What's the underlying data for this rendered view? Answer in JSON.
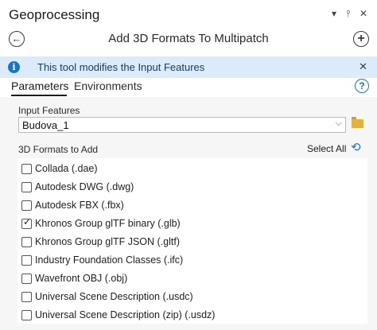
{
  "pane": {
    "title": "Geoprocessing",
    "controls": {
      "menu_glyph": "▾",
      "pin_glyph": "⫯",
      "close_glyph": "✕"
    }
  },
  "nav": {
    "back_glyph": "←",
    "add_glyph": "+",
    "tool_title": "Add 3D Formats To Multipatch"
  },
  "info": {
    "icon_glyph": "i",
    "message": "This tool modifies the Input Features",
    "close_glyph": "✕"
  },
  "tabs": {
    "parameters": "Parameters",
    "environments": "Environments",
    "help_glyph": "?"
  },
  "params": {
    "input_features_label": "Input Features",
    "input_features_value": "Budova_1",
    "chevron_glyph": "⌵",
    "formats_label": "3D Formats to Add",
    "select_all": "Select All",
    "refresh_glyph": "⟲",
    "formats": [
      {
        "label": "Collada (.dae)",
        "checked": false
      },
      {
        "label": "Autodesk DWG (.dwg)",
        "checked": false
      },
      {
        "label": "Autodesk FBX (.fbx)",
        "checked": false
      },
      {
        "label": "Khronos Group glTF binary (.glb)",
        "checked": true
      },
      {
        "label": "Khronos Group glTF JSON (.gltf)",
        "checked": false
      },
      {
        "label": "Industry Foundation Classes (.ifc)",
        "checked": false
      },
      {
        "label": "Wavefront OBJ (.obj)",
        "checked": false
      },
      {
        "label": "Universal Scene Description (.usdc)",
        "checked": false
      },
      {
        "label": "Universal Scene Description (zip) (.usdz)",
        "checked": false
      }
    ],
    "check_glyph": "✓"
  },
  "colors": {
    "accent": "#1b73c6",
    "info_bar_bg": "#dcebf9"
  }
}
